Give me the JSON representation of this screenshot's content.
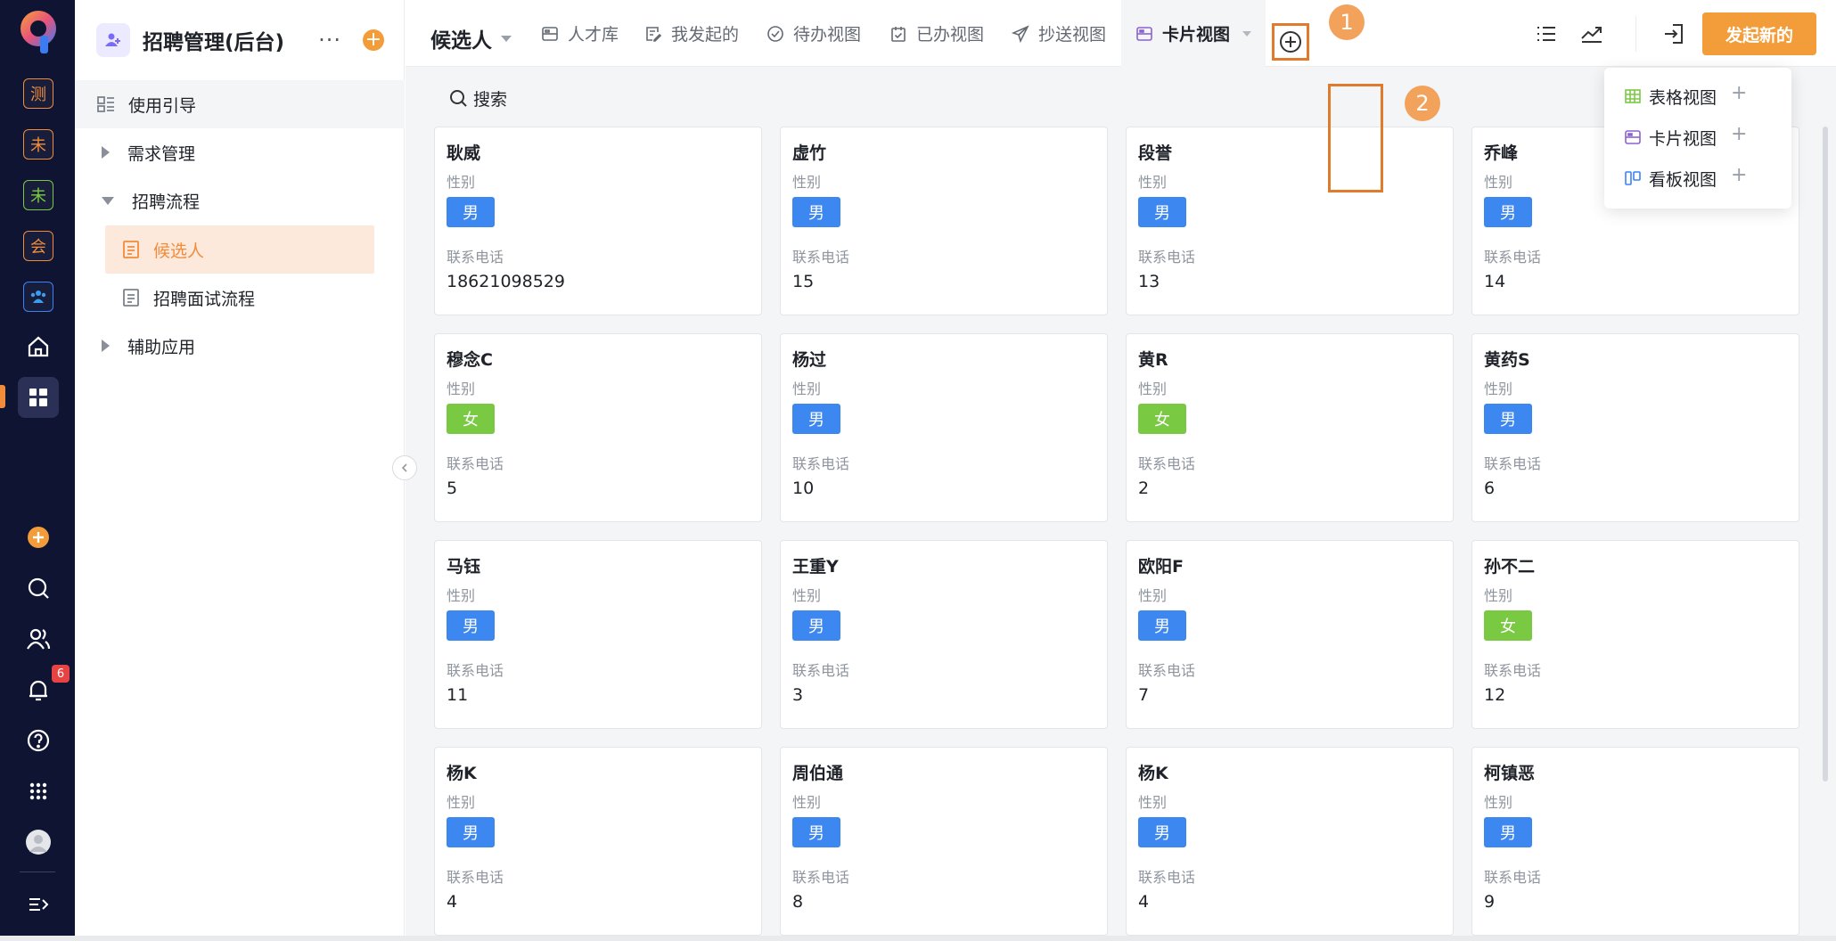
{
  "rail": {
    "apps": [
      {
        "label": "测",
        "color": "#f08c3a"
      },
      {
        "label": "未",
        "color": "#f08c3a"
      },
      {
        "label": "未",
        "color": "#7ac943"
      },
      {
        "label": "会",
        "color": "#f08c3a"
      }
    ],
    "notification_count": "6"
  },
  "sidebar": {
    "app_title": "招聘管理(后台)",
    "more": "···",
    "add": "+",
    "items": [
      {
        "label": "使用引导"
      },
      {
        "label": "需求管理"
      },
      {
        "label": "招聘流程"
      },
      {
        "label": "候选人"
      },
      {
        "label": "招聘面试流程"
      },
      {
        "label": "辅助应用"
      }
    ]
  },
  "header": {
    "view_title": "候选人",
    "tabs": [
      {
        "label": "人才库",
        "icon": "card-icon"
      },
      {
        "label": "我发起的",
        "icon": "edit-doc-icon"
      },
      {
        "label": "待办视图",
        "icon": "check-circle-icon"
      },
      {
        "label": "已办视图",
        "icon": "calendar-check-icon"
      },
      {
        "label": "抄送视图",
        "icon": "send-icon"
      },
      {
        "label": "卡片视图",
        "icon": "card-icon"
      }
    ],
    "step1": "1",
    "step2": "2",
    "primary_button": "发起新的"
  },
  "search": {
    "label": "搜索"
  },
  "dropdown": {
    "items": [
      {
        "label": "表格视图",
        "icon": "table-icon",
        "color": "#7ac943"
      },
      {
        "label": "卡片视图",
        "icon": "card-icon",
        "color": "#8a63d2"
      },
      {
        "label": "看板视图",
        "icon": "kanban-icon",
        "color": "#3b82f6"
      }
    ],
    "plus": "+"
  },
  "card_labels": {
    "gender": "性别",
    "phone": "联系电话"
  },
  "gender_colors": {
    "男": "#3d87f0",
    "女": "#7ac943"
  },
  "cards": [
    {
      "name": "耿威",
      "gender": "男",
      "phone": "18621098529"
    },
    {
      "name": "虚竹",
      "gender": "男",
      "phone": "15"
    },
    {
      "name": "段誉",
      "gender": "男",
      "phone": "13"
    },
    {
      "name": "乔峰",
      "gender": "男",
      "phone": "14"
    },
    {
      "name": "穆念C",
      "gender": "女",
      "phone": "5"
    },
    {
      "name": "杨过",
      "gender": "男",
      "phone": "10"
    },
    {
      "name": "黄R",
      "gender": "女",
      "phone": "2"
    },
    {
      "name": "黄药S",
      "gender": "男",
      "phone": "6"
    },
    {
      "name": "马钰",
      "gender": "男",
      "phone": "11"
    },
    {
      "name": "王重Y",
      "gender": "男",
      "phone": "3"
    },
    {
      "name": "欧阳F",
      "gender": "男",
      "phone": "7"
    },
    {
      "name": "孙不二",
      "gender": "女",
      "phone": "12"
    },
    {
      "name": "杨K",
      "gender": "男",
      "phone": "4"
    },
    {
      "name": "周伯通",
      "gender": "男",
      "phone": "8"
    },
    {
      "name": "杨K",
      "gender": "男",
      "phone": "4"
    },
    {
      "name": "柯镇恶",
      "gender": "男",
      "phone": "9"
    }
  ]
}
